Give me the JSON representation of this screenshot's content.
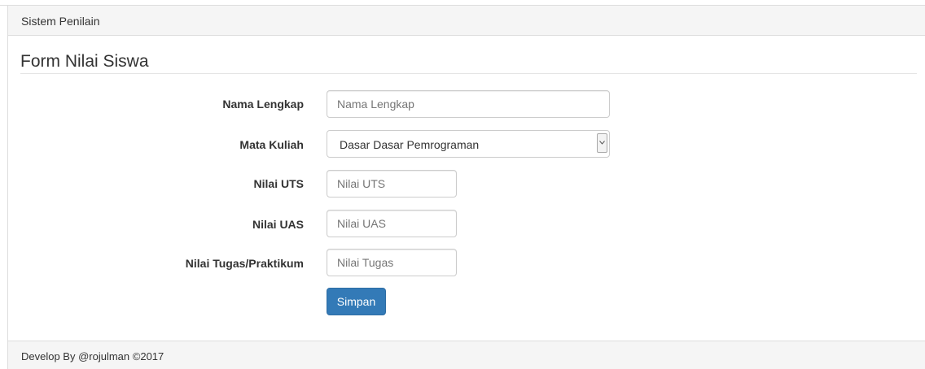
{
  "header": {
    "title": "Sistem Penilain"
  },
  "form": {
    "title": "Form Nilai Siswa",
    "fields": {
      "nama": {
        "label": "Nama Lengkap",
        "placeholder": "Nama Lengkap",
        "value": ""
      },
      "mata_kuliah": {
        "label": "Mata Kuliah",
        "selected": "Dasar Dasar Pemrograman"
      },
      "uts": {
        "label": "Nilai UTS",
        "placeholder": "Nilai UTS",
        "value": ""
      },
      "uas": {
        "label": "Nilai UAS",
        "placeholder": "Nilai UAS",
        "value": ""
      },
      "tugas": {
        "label": "Nilai Tugas/Praktikum",
        "placeholder": "Nilai Tugas",
        "value": ""
      }
    },
    "submit_label": "Simpan"
  },
  "footer": {
    "text": "Develop By @rojulman ©2017"
  },
  "colors": {
    "primary": "#337ab7",
    "panel_bg": "#f5f5f5",
    "border": "#dddddd"
  },
  "icons": {
    "select_arrow": "chevron-down-icon"
  }
}
